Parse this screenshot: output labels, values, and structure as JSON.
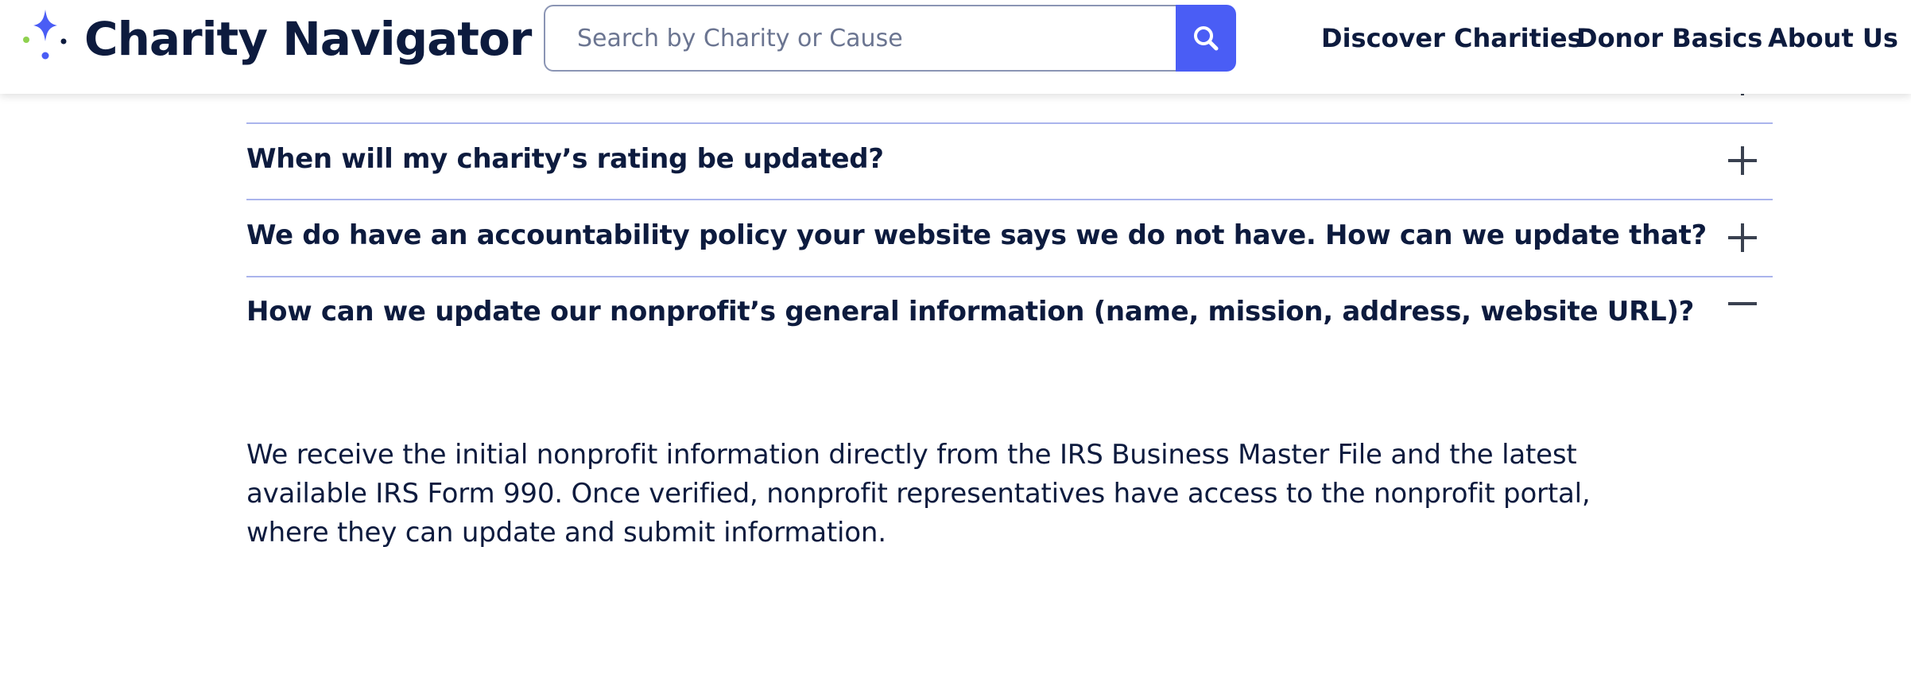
{
  "header": {
    "logo_text": "Charity Navigator",
    "search": {
      "placeholder": "Search by Charity or Cause",
      "value": ""
    },
    "nav": [
      {
        "label": "Discover Charities"
      },
      {
        "label": "Donor Basics"
      },
      {
        "label": "About Us"
      }
    ]
  },
  "faq": {
    "items": [
      {
        "question": "",
        "state": "collapsed",
        "toggle_icon": "plus-icon"
      },
      {
        "question": "When will my charity’s rating be updated?",
        "state": "collapsed",
        "toggle_icon": "plus-icon"
      },
      {
        "question": "We do have an accountability policy your website says we do not have. How can we update that?",
        "state": "collapsed",
        "toggle_icon": "plus-icon"
      },
      {
        "question": "How can we update our nonprofit’s general information (name, mission, address, website URL)?",
        "state": "expanded",
        "toggle_icon": "minus-icon"
      }
    ],
    "answer": "We receive the initial nonprofit information directly from the IRS Business Master File and the latest available IRS Form 990. Once verified, nonprofit representatives have access to the nonprofit portal, where they can update and submit information."
  },
  "colors": {
    "navy": "#0d1b3e",
    "accent_blue": "#4a5df5",
    "divider": "#aab4ec",
    "logo_green": "#8fd14f"
  }
}
